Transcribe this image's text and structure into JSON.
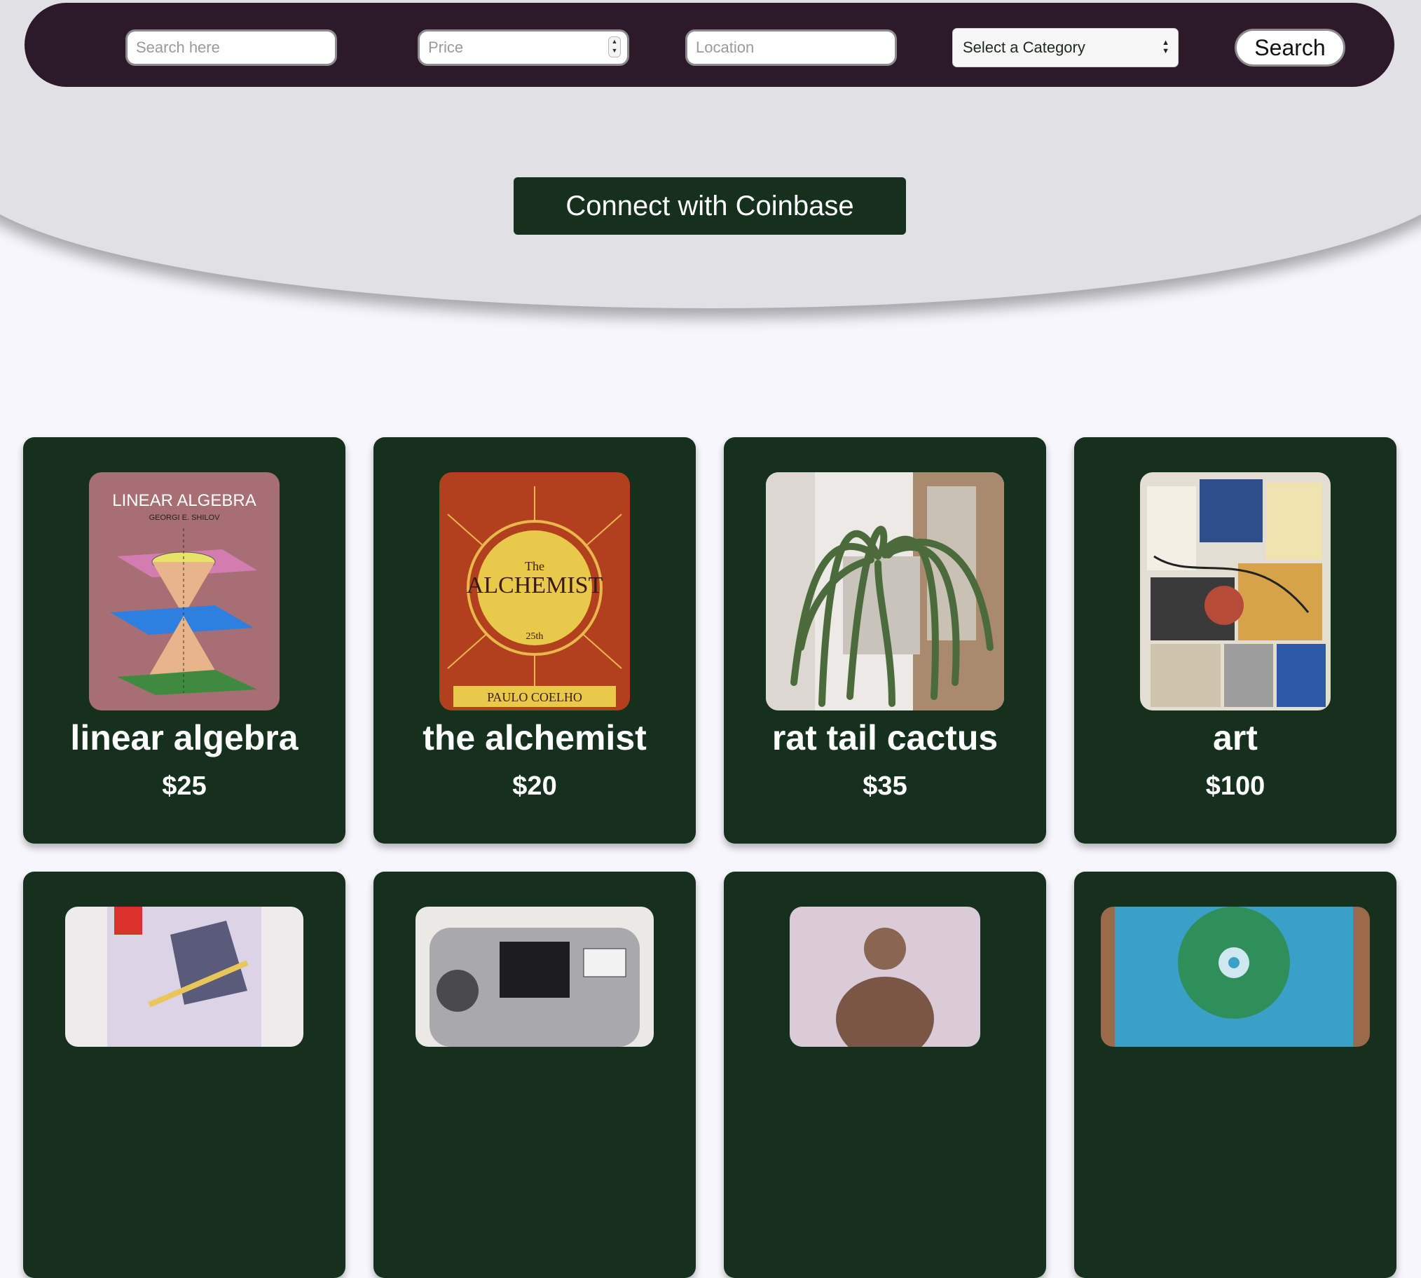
{
  "search": {
    "query_placeholder": "Search here",
    "price_placeholder": "Price",
    "location_placeholder": "Location",
    "category_selected": "Select a Category",
    "search_button": "Search"
  },
  "coinbase_button": "Connect with Coinbase",
  "colors": {
    "nav_bg": "#2c1a2b",
    "card_bg": "#15301d",
    "hero_bg": "#e1e0e4",
    "page_bg": "#f7f6fc"
  },
  "listings": [
    {
      "title": "linear algebra",
      "price": "$25",
      "image": "book-cover-linear-algebra"
    },
    {
      "title": "the alchemist",
      "price": "$20",
      "image": "book-cover-the-alchemist"
    },
    {
      "title": "rat tail cactus",
      "price": "$35",
      "image": "photo-rat-tail-cactus"
    },
    {
      "title": "art",
      "price": "$100",
      "image": "collage-art"
    },
    {
      "title": "",
      "price": "",
      "image": "nintendo-switch-game"
    },
    {
      "title": "",
      "price": "",
      "image": "film-camera"
    },
    {
      "title": "",
      "price": "",
      "image": "buddha-statue"
    },
    {
      "title": "",
      "price": "",
      "image": "gorillaz-cd"
    }
  ]
}
